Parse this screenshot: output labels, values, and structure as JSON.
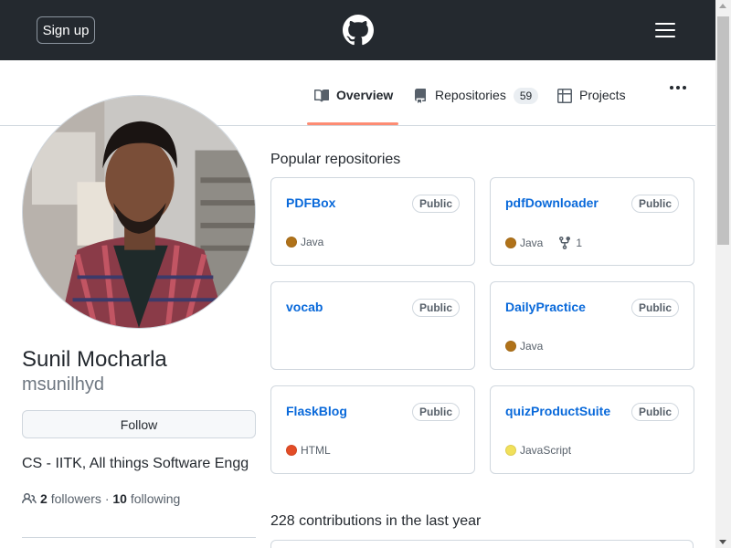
{
  "header": {
    "signup_label": "Sign up",
    "logo_icon": "github-mark-icon",
    "menu_icon": "hamburger-icon",
    "bg_color": "#24292f"
  },
  "tabs": [
    {
      "label": "Overview",
      "icon": "book-icon",
      "selected": true
    },
    {
      "label": "Repositories",
      "icon": "repo-icon",
      "count": "59"
    },
    {
      "label": "Projects",
      "icon": "table-icon"
    }
  ],
  "more_icon": "kebab-horizontal-icon",
  "profile": {
    "full_name": "Sunil Mocharla",
    "username": "msunilhyd",
    "follow_label": "Follow",
    "bio": "CS - IITK, All things Software Engg",
    "followers_count": "2",
    "followers_label": "followers",
    "separator": "·",
    "following_count": "10",
    "following_label": "following"
  },
  "popular": {
    "title": "Popular repositories",
    "repos": [
      {
        "name": "PDFBox",
        "visibility": "Public",
        "language": "Java",
        "lang_color": "#b07219",
        "forks": ""
      },
      {
        "name": "pdfDownloader",
        "visibility": "Public",
        "language": "Java",
        "lang_color": "#b07219",
        "forks": "1"
      },
      {
        "name": "vocab",
        "visibility": "Public",
        "language": "",
        "lang_color": "",
        "forks": ""
      },
      {
        "name": "DailyPractice",
        "visibility": "Public",
        "language": "Java",
        "lang_color": "#b07219",
        "forks": ""
      },
      {
        "name": "FlaskBlog",
        "visibility": "Public",
        "language": "HTML",
        "lang_color": "#e34c26",
        "forks": ""
      },
      {
        "name": "quizProductSuite",
        "visibility": "Public",
        "language": "JavaScript",
        "lang_color": "#f1e05a",
        "forks": ""
      }
    ]
  },
  "contributions": {
    "title": "228 contributions in the last year"
  },
  "colors": {
    "link": "#0969da",
    "tab_underline": "#fd8c73"
  }
}
